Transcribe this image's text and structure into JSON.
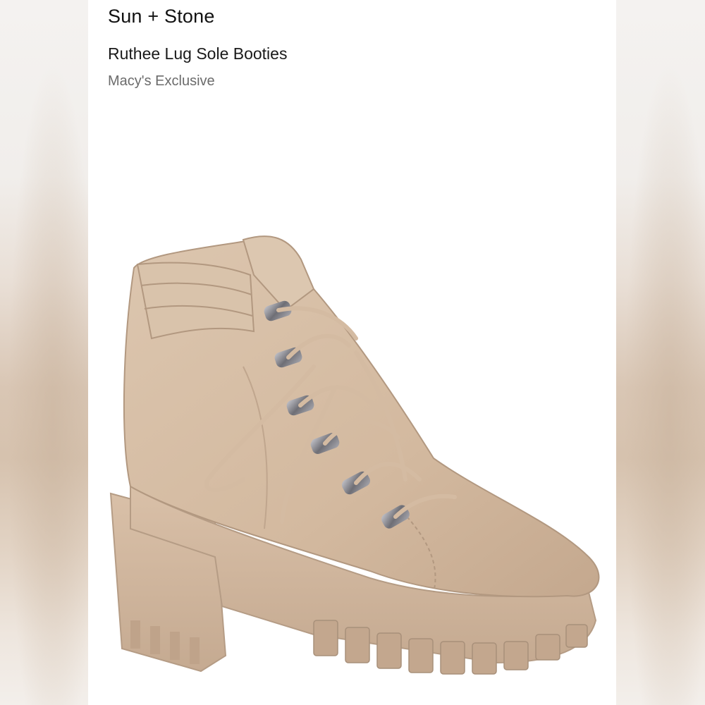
{
  "product": {
    "brand": "Sun + Stone",
    "name": "Ruthee Lug Sole Booties",
    "badge": "Macy's Exclusive"
  },
  "image": {
    "subject": "boot-photo",
    "colors": {
      "suede": "#d8c0a8",
      "suede_shadow": "#b89e86",
      "sole": "#d2b8a0",
      "sole_shadow": "#b39a84",
      "hardware": "#7a7a80"
    }
  }
}
